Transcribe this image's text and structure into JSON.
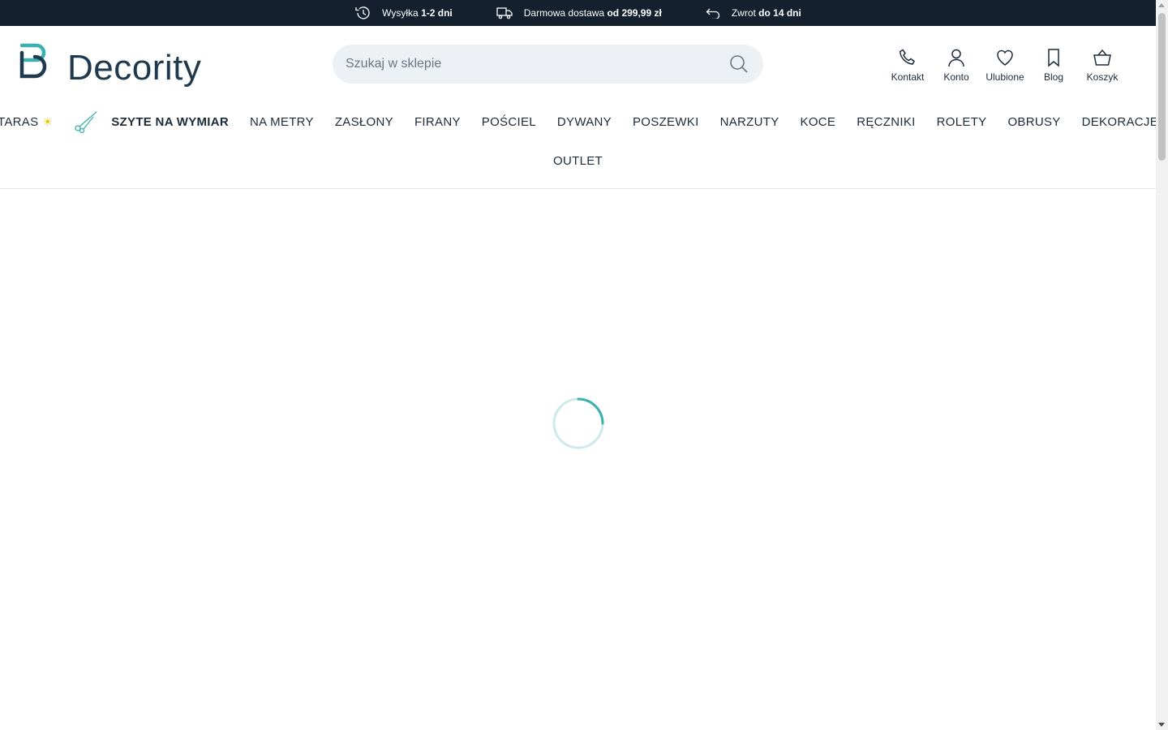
{
  "topbar": {
    "perks": [
      {
        "icon": "clock-history-icon",
        "text": "Wysyłka ",
        "bold": "1-2 dni"
      },
      {
        "icon": "delivery-truck-icon",
        "text": "Darmowa dostawa ",
        "bold": "od 299,99 zł"
      },
      {
        "icon": "return-arrow-icon",
        "text": "Zwrot ",
        "bold": "do 14 dni"
      }
    ]
  },
  "header": {
    "logo_text": "Decority",
    "search": {
      "placeholder": "Szukaj w sklepie",
      "value": ""
    },
    "actions": [
      {
        "label": "Kontakt",
        "icon": "phone-icon"
      },
      {
        "label": "Konto",
        "icon": "user-icon"
      },
      {
        "label": "Ulubione",
        "icon": "heart-icon"
      },
      {
        "label": "Blog",
        "icon": "bookmark-icon"
      },
      {
        "label": "Koszyk",
        "icon": "basket-icon"
      }
    ]
  },
  "nav": {
    "taras": "TARAS",
    "szyte": "SZYTE NA WYMIAR",
    "items": [
      "NA METRY",
      "ZASŁONY",
      "FIRANY",
      "POŚCIEL",
      "DYWANY",
      "POSZEWKI",
      "NARZUTY",
      "KOCE",
      "RĘCZNIKI",
      "ROLETY",
      "OBRUSY",
      "DEKORACJE"
    ],
    "outlet": "OUTLET"
  },
  "colors": {
    "topbar_bg": "#14202e",
    "brand_teal": "#3bb0ae",
    "brand_navy": "#1f3a4f",
    "search_bg": "#edf1f5"
  }
}
